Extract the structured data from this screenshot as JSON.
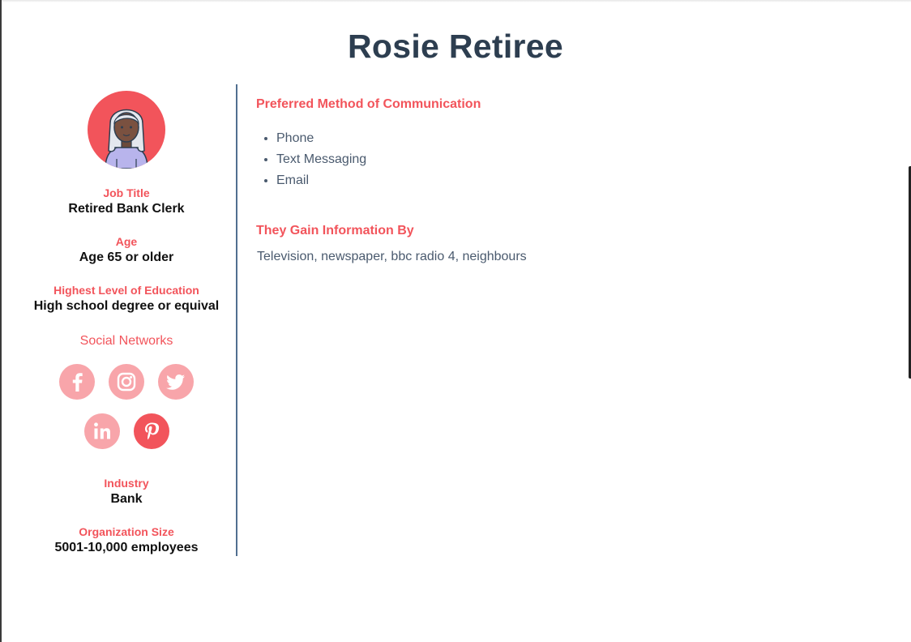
{
  "persona": {
    "name": "Rosie Retiree"
  },
  "sidebar": {
    "job_title": {
      "label": "Job Title",
      "value": "Retired Bank Clerk"
    },
    "age": {
      "label": "Age",
      "value": "Age 65 or older"
    },
    "education": {
      "label": "Highest Level of Education",
      "value": "High school degree or equival"
    },
    "social": {
      "label": "Social Networks",
      "networks": [
        {
          "name": "facebook",
          "icon": "facebook-icon",
          "selected": false
        },
        {
          "name": "instagram",
          "icon": "instagram-icon",
          "selected": false
        },
        {
          "name": "twitter",
          "icon": "twitter-icon",
          "selected": false
        },
        {
          "name": "linkedin",
          "icon": "linkedin-icon",
          "selected": false
        },
        {
          "name": "pinterest",
          "icon": "pinterest-icon",
          "selected": true
        }
      ]
    },
    "industry": {
      "label": "Industry",
      "value": "Bank"
    },
    "org_size": {
      "label": "Organization Size",
      "value": "5001-10,000 employees"
    }
  },
  "main": {
    "communication": {
      "heading": "Preferred Method of Communication",
      "items": [
        "Phone",
        "Text Messaging",
        "Email"
      ]
    },
    "information": {
      "heading": "They Gain Information By",
      "text": "Television, newspaper, bbc radio 4, neighbours"
    }
  },
  "colors": {
    "accent": "#f2545b",
    "accent_light": "#f8a5aa",
    "title": "#2d3e50",
    "divider": "#516f90",
    "body_text": "#4a5a6e"
  }
}
